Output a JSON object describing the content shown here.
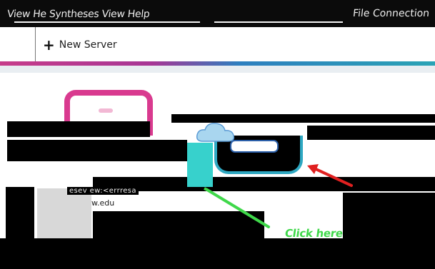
{
  "titlebar": {
    "left_text": "View He Syntheses View Help",
    "right_text": "File Connection"
  },
  "toolbar": {
    "new_server_label": "New Server",
    "plus_icon": "plus-icon"
  },
  "server": {
    "host_label": "esev ew:<errresa",
    "domain_label": "w.edu"
  },
  "annotation": {
    "callout_text": "Click here"
  },
  "colors": {
    "pink": "#d93a8f",
    "teal": "#2ea8c2",
    "green": "#3fd84a",
    "red": "#e02020",
    "black": "#000000"
  },
  "icons": [
    "plus-icon",
    "cloud-icon",
    "red-arrow-icon",
    "green-arrow-icon"
  ]
}
